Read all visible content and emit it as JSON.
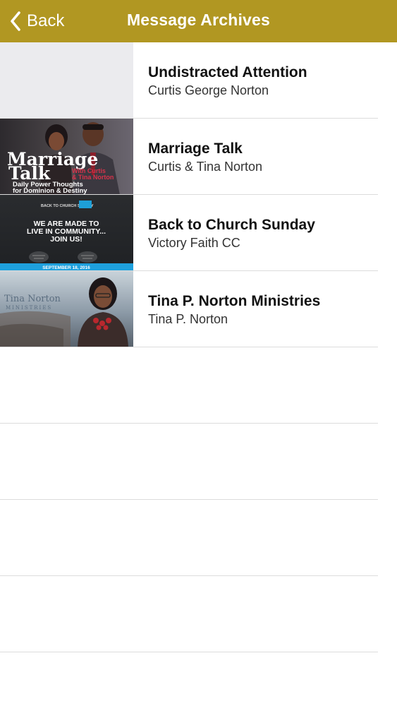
{
  "nav": {
    "back_label": "Back",
    "title": "Message Archives"
  },
  "items": [
    {
      "title": "Undistracted Attention",
      "subtitle": "Curtis George Norton",
      "thumbnail": "placeholder"
    },
    {
      "title": "Marriage Talk",
      "subtitle": "Curtis & Tina Norton",
      "thumbnail": "marriage-talk-cover",
      "thumb_text": {
        "line1": "Marriage",
        "line2": "Talk",
        "with": "With Curtis",
        "names": "& Tina Norton",
        "tagline1": "Daily Power Thoughts",
        "tagline2": "for Dominion & Destiny"
      }
    },
    {
      "title": "Back to Church Sunday",
      "subtitle": "Victory Faith CC",
      "thumbnail": "back-to-church-flyer",
      "thumb_text": {
        "badge": "BACK TO CHURCH SUNDAY",
        "line1": "WE ARE MADE TO",
        "line2": "LIVE IN COMMUNITY...",
        "line3": "JOIN US!",
        "date": "SEPTEMBER 18, 2016"
      }
    },
    {
      "title": "Tina P. Norton Ministries",
      "subtitle": "Tina P. Norton",
      "thumbnail": "tina-norton-portrait",
      "thumb_text": {
        "name": "Tina Norton",
        "ministries": "MINISTRIES"
      }
    }
  ],
  "colors": {
    "navbar": "#b19722",
    "divider": "#dcdcdc",
    "placeholder": "#ebebee"
  }
}
